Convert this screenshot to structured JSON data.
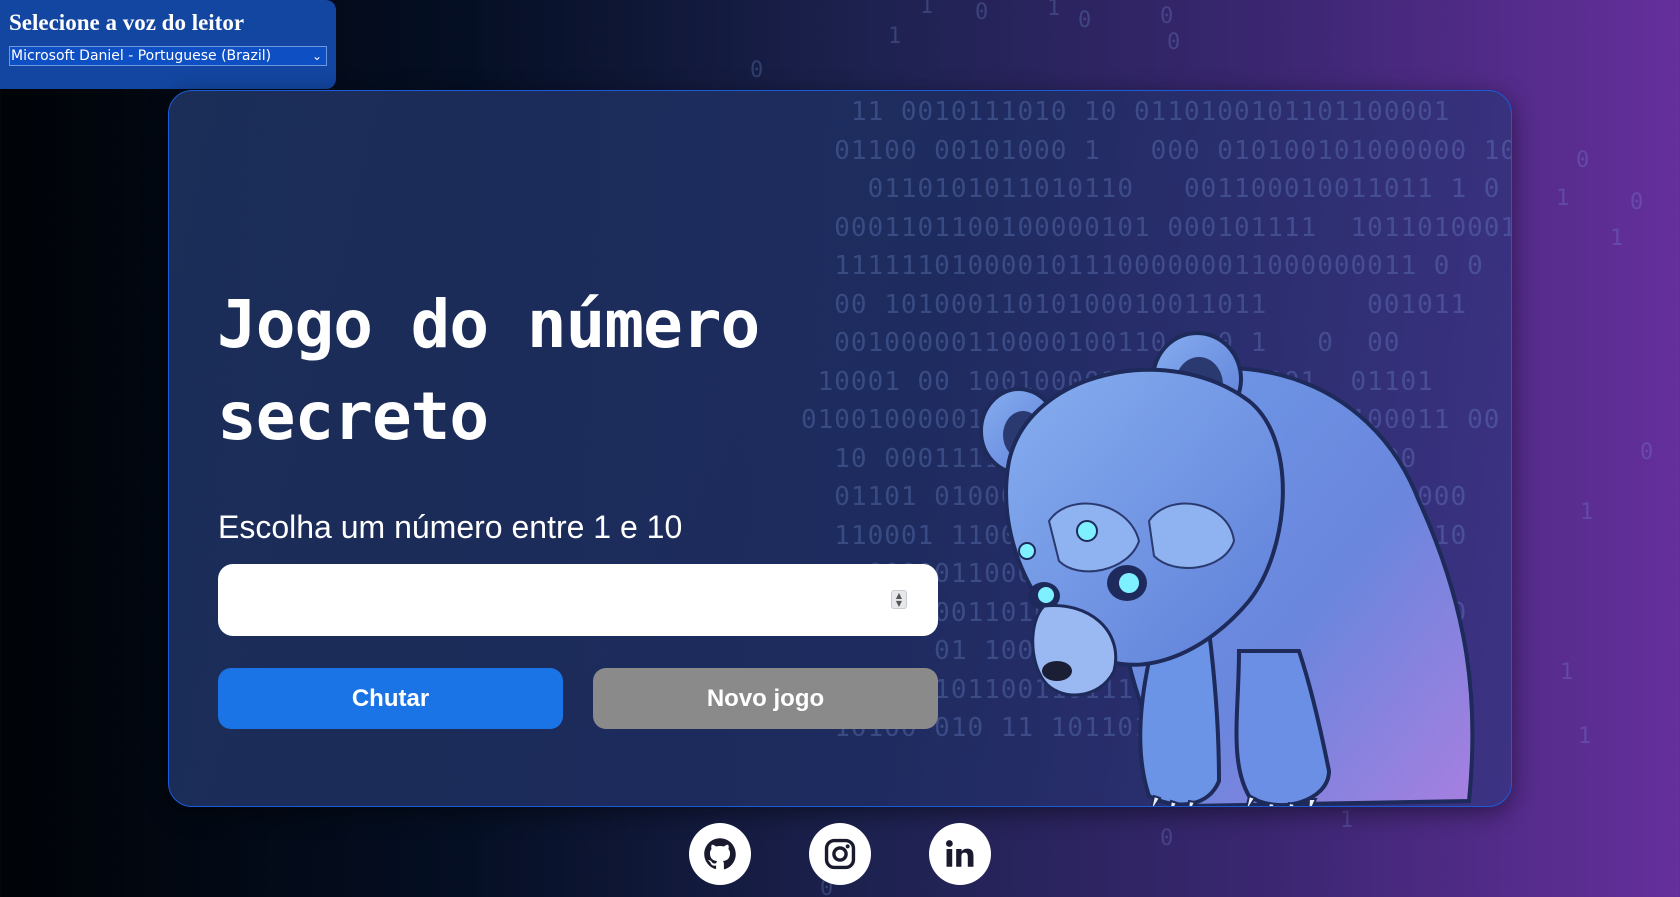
{
  "voice": {
    "label": "Selecione a voz do leitor",
    "selected": "Microsoft Daniel - Portuguese (Brazil)"
  },
  "game": {
    "title_line1": "Jogo do número",
    "title_line2": "secreto",
    "instruction": "Escolha um número entre 1 e 10",
    "input_value": "",
    "guess_button": "Chutar",
    "new_game_button": "Novo jogo"
  },
  "socials": [
    {
      "name": "github",
      "icon": "github-icon"
    },
    {
      "name": "instagram",
      "icon": "instagram-icon"
    },
    {
      "name": "linkedin",
      "icon": "linkedin-icon"
    }
  ],
  "colors": {
    "primary_button": "#1a74e6",
    "secondary_button": "#8a8a8a",
    "card_border": "#1a5bd8",
    "voice_panel": "#1346a0"
  }
}
